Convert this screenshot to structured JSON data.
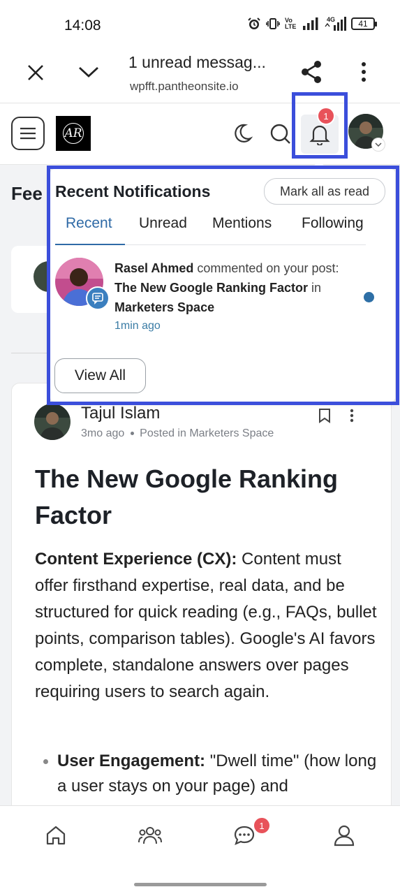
{
  "status_bar": {
    "time": "14:08",
    "battery": "41",
    "network": "4G",
    "volte": "Vo LTE"
  },
  "browser": {
    "title": "1 unread messag...",
    "url": "wpfft.pantheonsite.io"
  },
  "header": {
    "logo_text": "AR",
    "bell_badge": "1"
  },
  "feed": {
    "title_fragment": "Fee"
  },
  "notifications": {
    "title": "Recent Notifications",
    "mark_all": "Mark all as read",
    "tabs": [
      "Recent",
      "Unread",
      "Mentions",
      "Following"
    ],
    "active_tab": "Recent",
    "item": {
      "user": "Rasel Ahmed",
      "action1": " commented on your post: ",
      "post": "The New Google Ranking Factor",
      "action2": " in ",
      "space": "Marketers Space",
      "time": "1min ago",
      "unread": true
    },
    "view_all": "View All"
  },
  "post": {
    "author": "Tajul Islam",
    "age": "3mo ago",
    "posted_in": "Posted in Marketers Space",
    "title": "The New Google Ranking Factor",
    "body_bold": "Content Experience (CX):",
    "body": " Content must offer firsthand expertise, real data, and be structured for quick reading (e.g., FAQs, bullet points, comparison tables). Google's AI favors complete, standalone answers over pages requiring users to search again.",
    "bullet_bold": "User Engagement:",
    "bullet": " \"Dwell time\" (how long a user stays on your page) and"
  },
  "bottom_nav": {
    "messages_badge": "1"
  },
  "colors": {
    "accent": "#2f6aa6",
    "badge": "#e8525a",
    "highlight": "#3b4edb"
  }
}
